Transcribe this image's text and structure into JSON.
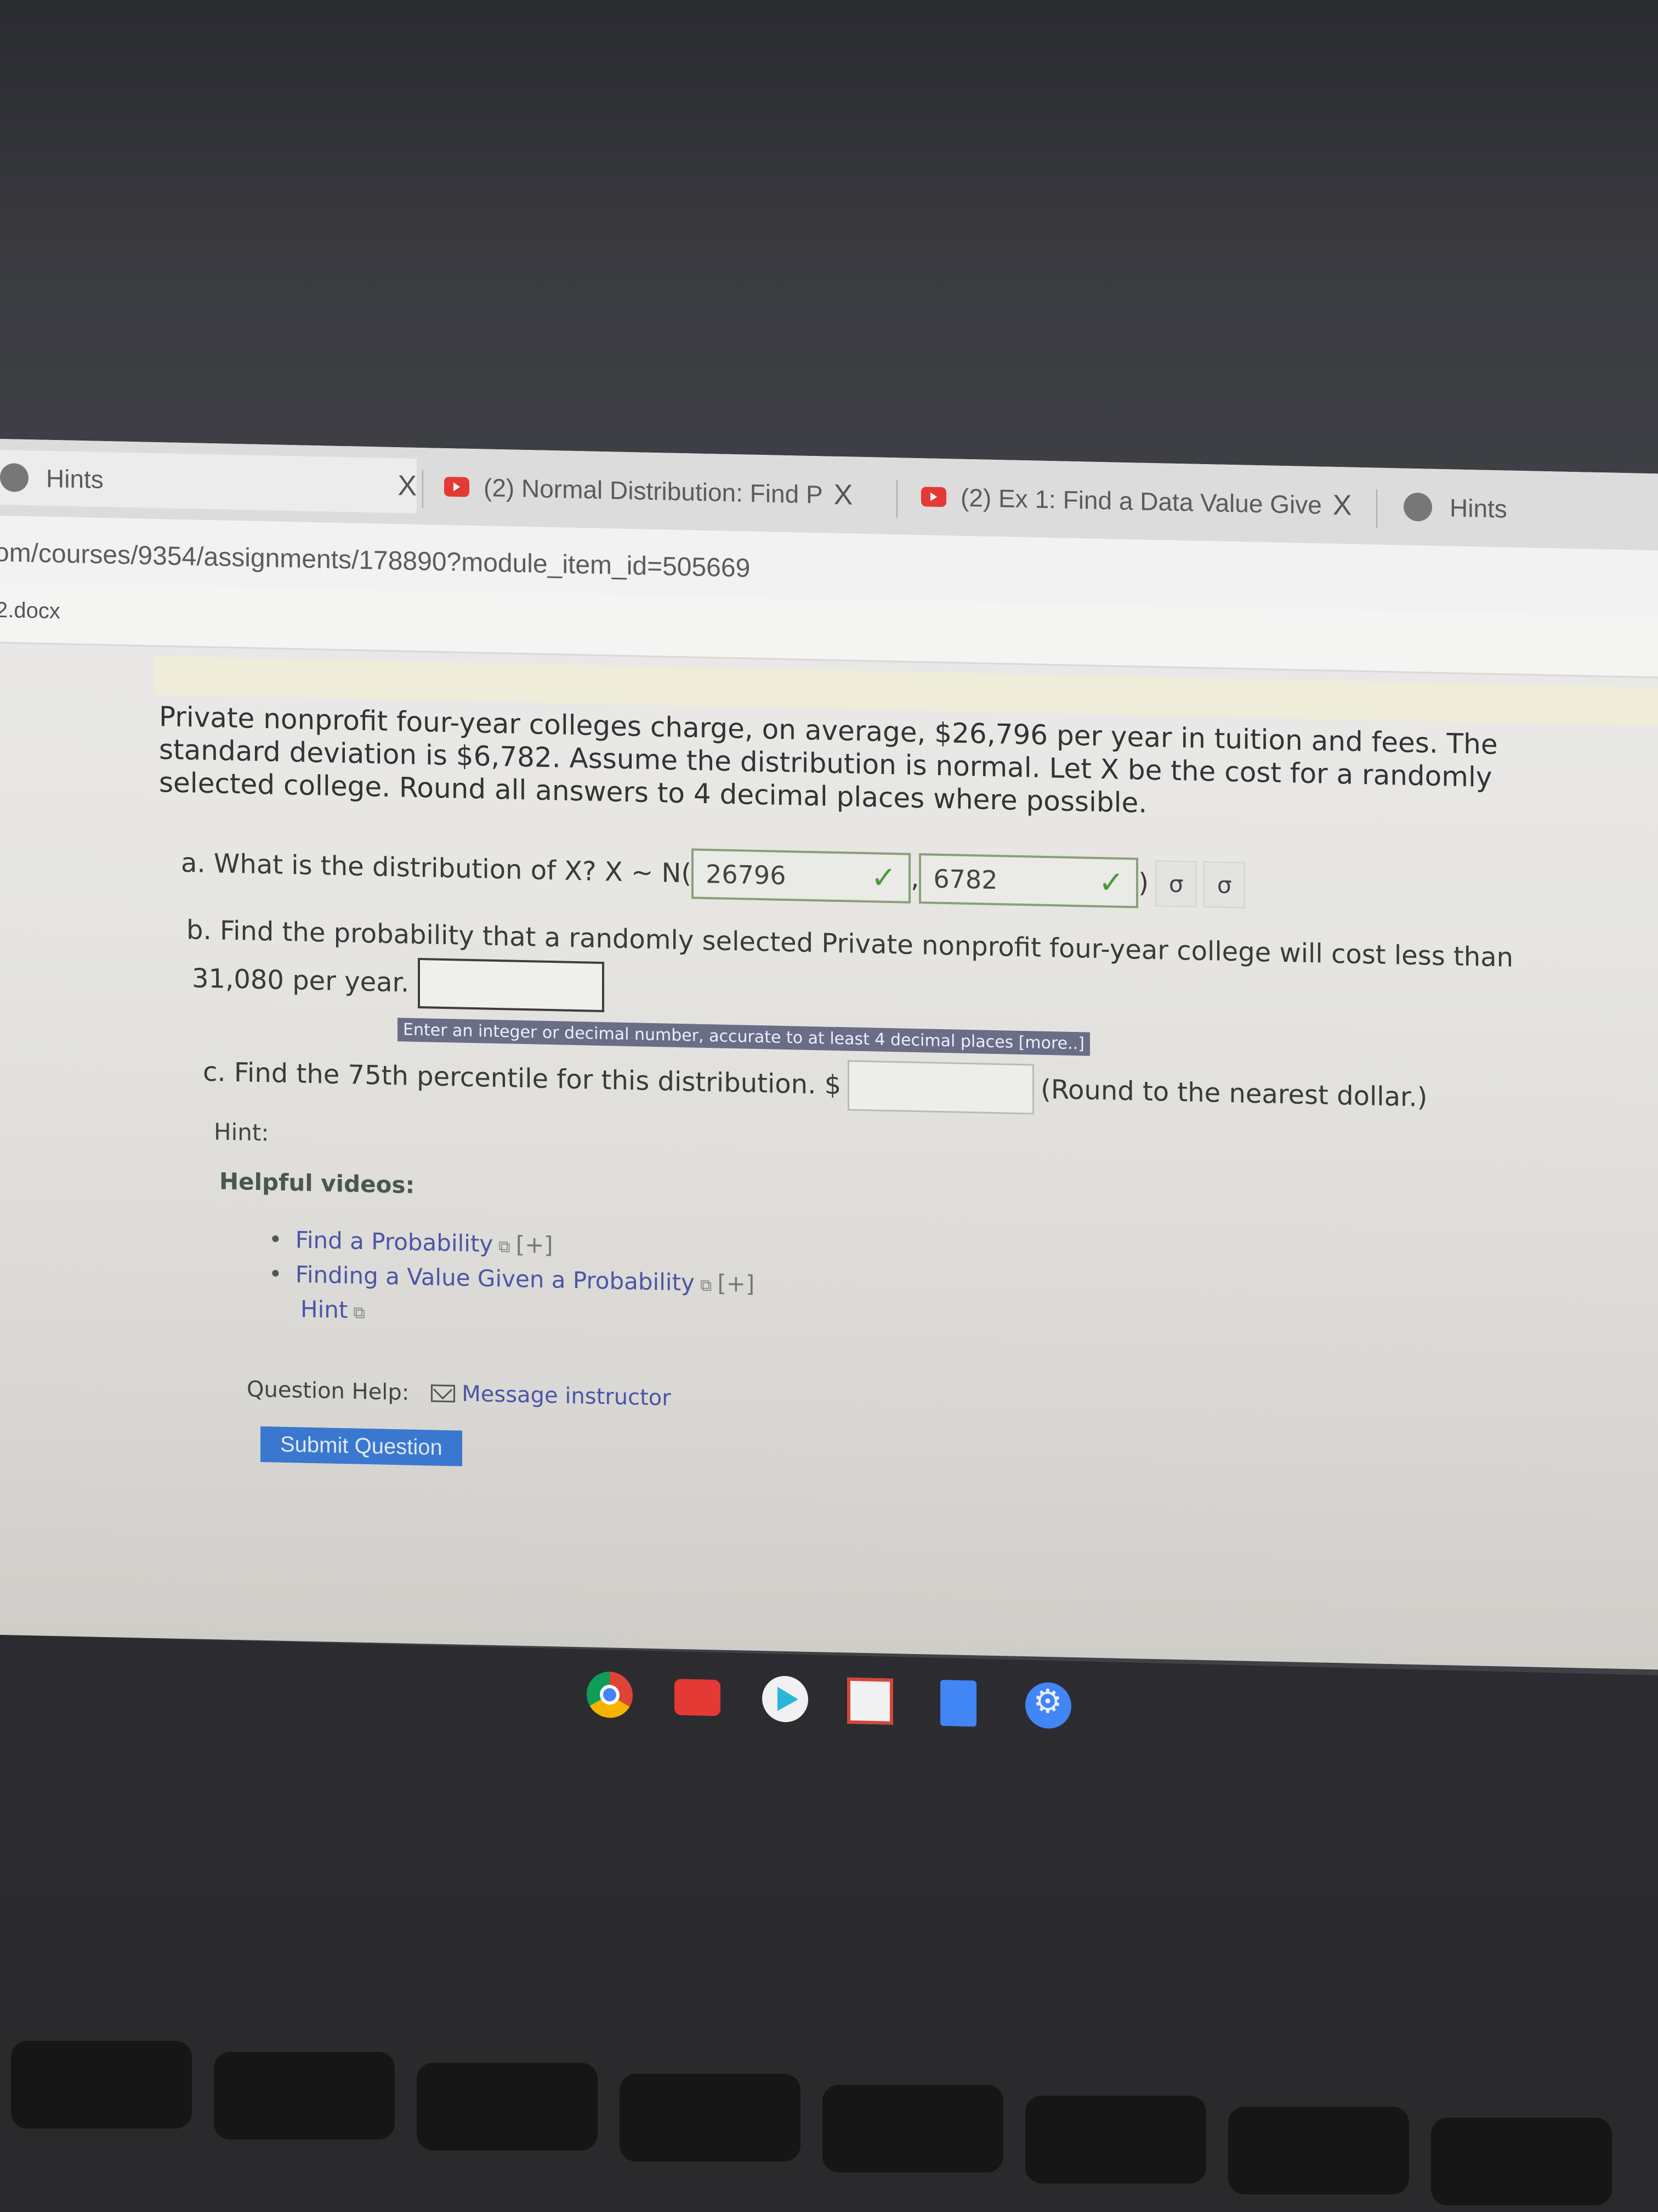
{
  "browser": {
    "tabs": [
      {
        "label": "Hints",
        "icon": "hint-favicon",
        "closable": true,
        "active": true
      },
      {
        "label": "(2) Normal Distribution: Find P",
        "icon": "youtube-icon",
        "closable": true,
        "active": false
      },
      {
        "label": "(2) Ex 1: Find a Data Value Give",
        "icon": "youtube-icon",
        "closable": true,
        "active": false
      },
      {
        "label": "Hints",
        "icon": "hint-favicon",
        "closable": false,
        "active": false
      }
    ],
    "close_glyph": "X",
    "url": "om/courses/9354/assignments/178890?module_item_id=505669",
    "file_label": "2.docx"
  },
  "question": {
    "stem": "Private nonprofit four-year colleges charge, on average, $26,796 per year in tuition and fees. The standard deviation is $6,782. Assume the distribution is normal. Let X be the cost for a randomly selected college. Round all answers to 4 decimal places where possible.",
    "part_a": {
      "prompt": "a. What is the distribution of X? X ~ N(",
      "mean_value": "26796",
      "sd_value": "6782",
      "separator": ",",
      "closing": ")",
      "correct_mark": "✓",
      "symbol_buttons": [
        "σ",
        "σ"
      ]
    },
    "part_b": {
      "prompt_line1": "b. Find the probability that a randomly selected Private nonprofit four-year college will cost less than",
      "prompt_line2": "31,080 per year.",
      "value": "",
      "tooltip": "Enter an integer or decimal number, accurate to at least 4 decimal places [more..]"
    },
    "part_c": {
      "prompt": "c. Find the 75th percentile for this distribution. $",
      "value": "",
      "suffix": "(Round to the nearest dollar.)"
    }
  },
  "hints": {
    "hint_label": "Hint:",
    "helpful_videos_label": "Helpful videos:",
    "videos": [
      {
        "label": "Find a Probability",
        "expand": "[+]"
      },
      {
        "label": "Finding a Value Given a Probability",
        "expand": "[+]"
      }
    ],
    "hint_link": "Hint",
    "external_glyph": "⧉"
  },
  "question_help": {
    "label": "Question Help:",
    "message_link": "Message instructor"
  },
  "submit_label": "Submit Question",
  "shelf_apps": [
    "chrome",
    "youtube",
    "play-store",
    "gmail",
    "docs",
    "settings"
  ]
}
